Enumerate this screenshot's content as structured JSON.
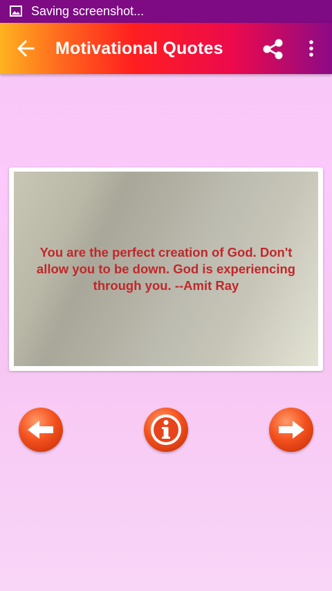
{
  "status_bar": {
    "text": "Saving screenshot...",
    "icon": "image-icon"
  },
  "app_bar": {
    "title": "Motivational Quotes",
    "back_icon": "arrow-back-icon",
    "share_icon": "share-icon",
    "more_icon": "more-vert-icon"
  },
  "quote": {
    "text": "You are the perfect creation of God. Don't allow you to be down. God is experiencing through you. --Amit Ray",
    "color": "#c0282b"
  },
  "controls": {
    "previous_icon": "arrow-left-icon",
    "info_icon": "info-icon",
    "next_icon": "arrow-right-icon"
  },
  "colors": {
    "status_bar": "#7e0a84",
    "button": "#f4521e"
  }
}
